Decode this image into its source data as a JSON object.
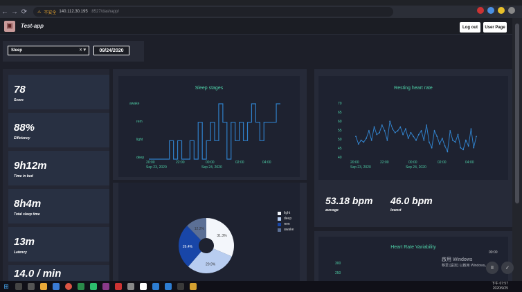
{
  "browser": {
    "url_warning": "不安全",
    "url_host": "140.112.30.195",
    "url_rest": ":8527/dashapp/"
  },
  "header": {
    "title": "Test-app",
    "logout_label": "Log out",
    "userpage_label": "User Page"
  },
  "filter": {
    "selected": "Sleep",
    "clear_glyph": "×",
    "arrow_glyph": "▾",
    "date": "09/24/2020"
  },
  "stats": [
    {
      "value": "78",
      "label": "Score"
    },
    {
      "value": "88%",
      "label": "Efficiency"
    },
    {
      "value": "9h12m",
      "label": "Time in bed"
    },
    {
      "value": "8h4m",
      "label": "Total sleep time"
    },
    {
      "value": "13m",
      "label": "Latency"
    },
    {
      "value": "14.0 / min",
      "label": ""
    }
  ],
  "sleep_chart": {
    "title": "Sleep stages",
    "y_ticks": [
      "awake",
      "rem",
      "light",
      "deep"
    ],
    "x_ticks": [
      "20:00",
      "22:00",
      "00:00",
      "02:00",
      "04:00"
    ],
    "x_dates": [
      "Sep 23, 2020",
      "Sep 24, 2020"
    ],
    "line_color": "#2f7fc8"
  },
  "hr_chart": {
    "title": "Resting heart rate",
    "y_ticks": [
      "70",
      "65",
      "60",
      "55",
      "50",
      "45",
      "40"
    ],
    "x_ticks": [
      "20:00",
      "22:00",
      "00:00",
      "02:00",
      "04:00"
    ],
    "x_dates": [
      "Sep 23, 2020",
      "Sep 24, 2020"
    ]
  },
  "pie": {
    "legend": [
      {
        "label": "light",
        "color": "#f3f6fb"
      },
      {
        "label": "deep",
        "color": "#b8cdf0"
      },
      {
        "label": "rem",
        "color": "#1846a8"
      },
      {
        "label": "awake",
        "color": "#5b6f95"
      }
    ],
    "labels": [
      "31.3%",
      "29.9%",
      "26.4%",
      "12.2%"
    ]
  },
  "heart_rate": {
    "average_value": "53.18 bpm",
    "average_label": "average",
    "lowest_value": "46.0 bpm",
    "lowest_label": "lowest"
  },
  "hrv": {
    "title": "Heart Rate Variability",
    "y_ticks": [
      "300",
      "250"
    ]
  },
  "windows": {
    "activate_title": "啟用 Windows",
    "activate_sub": "移至 [設定] 以啟用 Windows。",
    "toast_time": "00:00",
    "clock_time": "下午 07:57",
    "clock_date": "2020/9/25"
  },
  "chart_data": [
    {
      "type": "line",
      "title": "Sleep stages",
      "y_categories": [
        "deep",
        "light",
        "rem",
        "awake"
      ],
      "x_range": [
        "20:00",
        "04:00"
      ],
      "series": [
        {
          "values_stage_index": [
            0,
            0,
            0,
            0,
            0,
            1,
            0,
            1,
            0,
            0,
            1,
            0,
            2,
            0,
            1,
            2,
            1,
            3,
            2,
            0,
            2,
            1,
            2,
            1,
            2,
            3,
            2,
            1,
            2,
            2,
            2,
            3
          ]
        }
      ]
    },
    {
      "type": "line",
      "title": "Resting heart rate",
      "ylim": [
        40,
        70
      ],
      "x_range": [
        "20:00",
        "04:00"
      ],
      "series": [
        {
          "values": [
            52,
            48,
            50,
            49,
            51,
            55,
            50,
            57,
            53,
            54,
            58,
            55,
            50,
            60,
            56,
            54,
            55,
            57,
            53,
            56,
            51,
            54,
            52,
            50,
            53,
            55,
            50,
            58,
            49,
            46,
            55,
            52,
            48,
            51,
            47,
            44,
            55,
            50,
            49,
            53,
            46,
            45,
            50,
            47,
            56,
            46,
            52
          ]
        }
      ]
    },
    {
      "type": "pie",
      "title": "",
      "series": [
        {
          "name": "",
          "values": [
            31.3,
            29.9,
            26.4,
            12.2
          ]
        }
      ],
      "categories": [
        "light",
        "deep",
        "rem",
        "awake"
      ]
    }
  ]
}
